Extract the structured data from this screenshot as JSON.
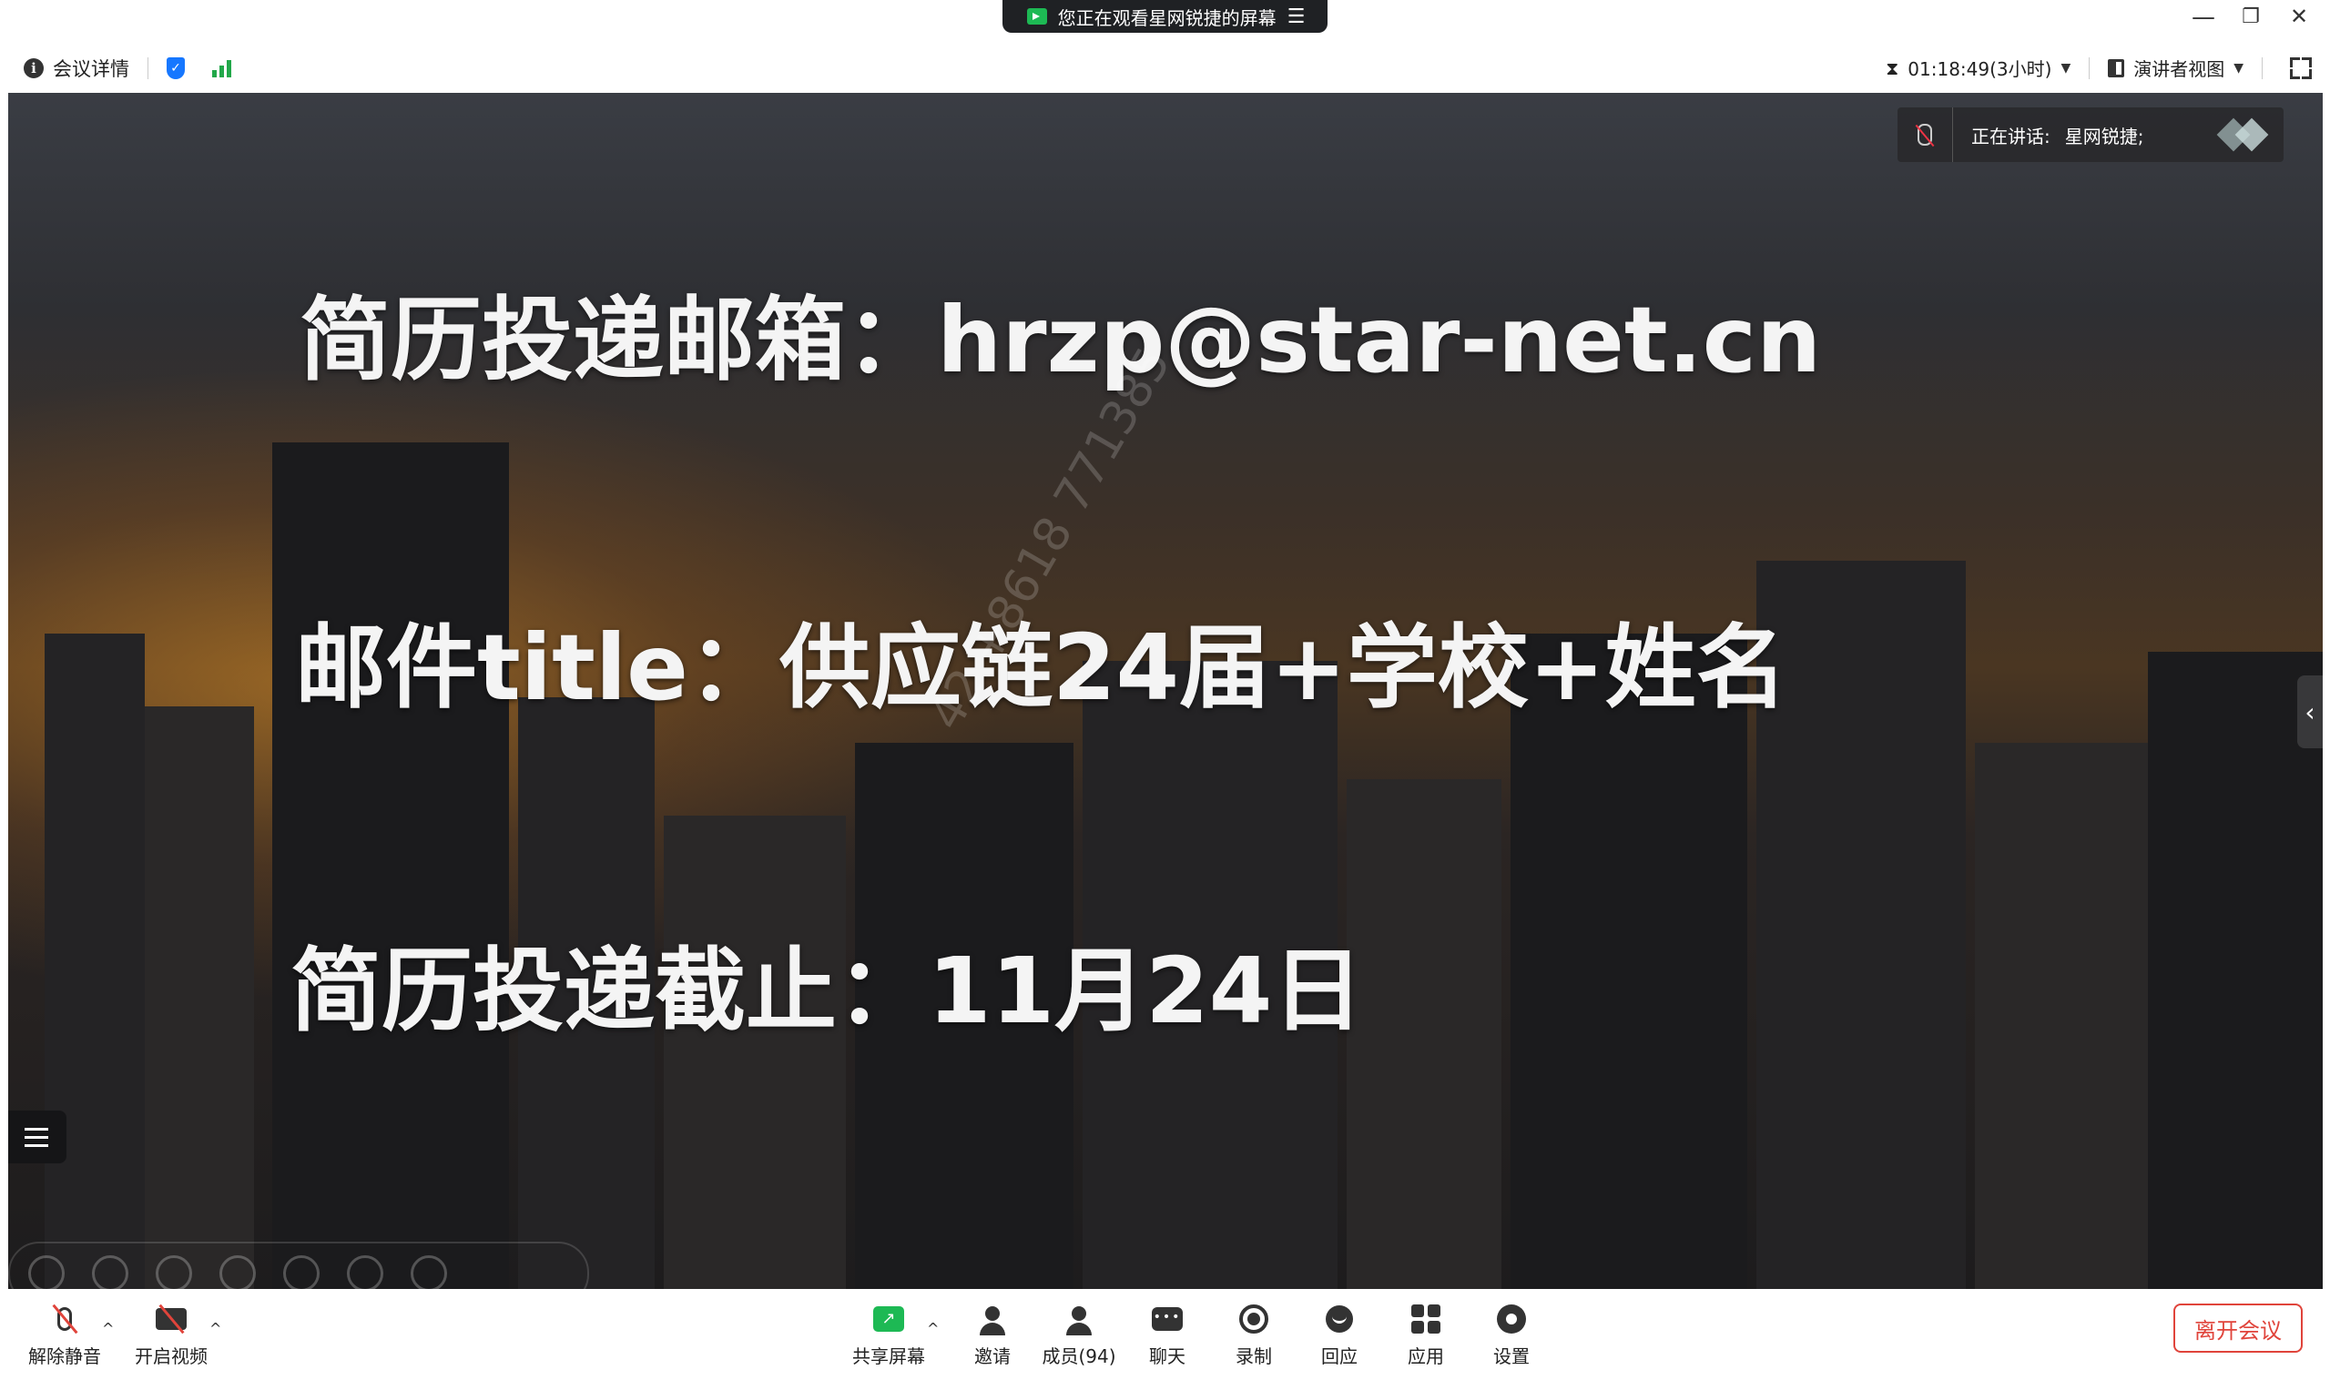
{
  "share_banner": {
    "text": "您正在观看星网锐捷的屏幕",
    "menu_glyph": "☰"
  },
  "window_controls": {
    "minimize": "—",
    "restore": "❐",
    "close": "✕"
  },
  "infobar": {
    "meeting_details": "会议详情",
    "timer": "01:18:49(3小时)",
    "presenter_view": "演讲者视图"
  },
  "slide": {
    "line1": "简历投递邮箱：hrzp@star-net.cn",
    "line2": "邮件title：供应链24届+学校+姓名",
    "line3": "简历投递截止：11月24日",
    "watermark": "42 +8618 771385"
  },
  "speaker": {
    "label": "正在讲话:",
    "name": "星网锐捷;"
  },
  "toolbar": {
    "unmute": "解除静音",
    "start_video": "开启视频",
    "share_screen": "共享屏幕",
    "invite": "邀请",
    "members": "成员(94)",
    "chat": "聊天",
    "record": "录制",
    "react": "回应",
    "apps": "应用",
    "settings": "设置",
    "leave": "离开会议"
  },
  "colors": {
    "accent_green": "#1db954",
    "shield_blue": "#1677ff",
    "leave_red": "#e0443b"
  }
}
